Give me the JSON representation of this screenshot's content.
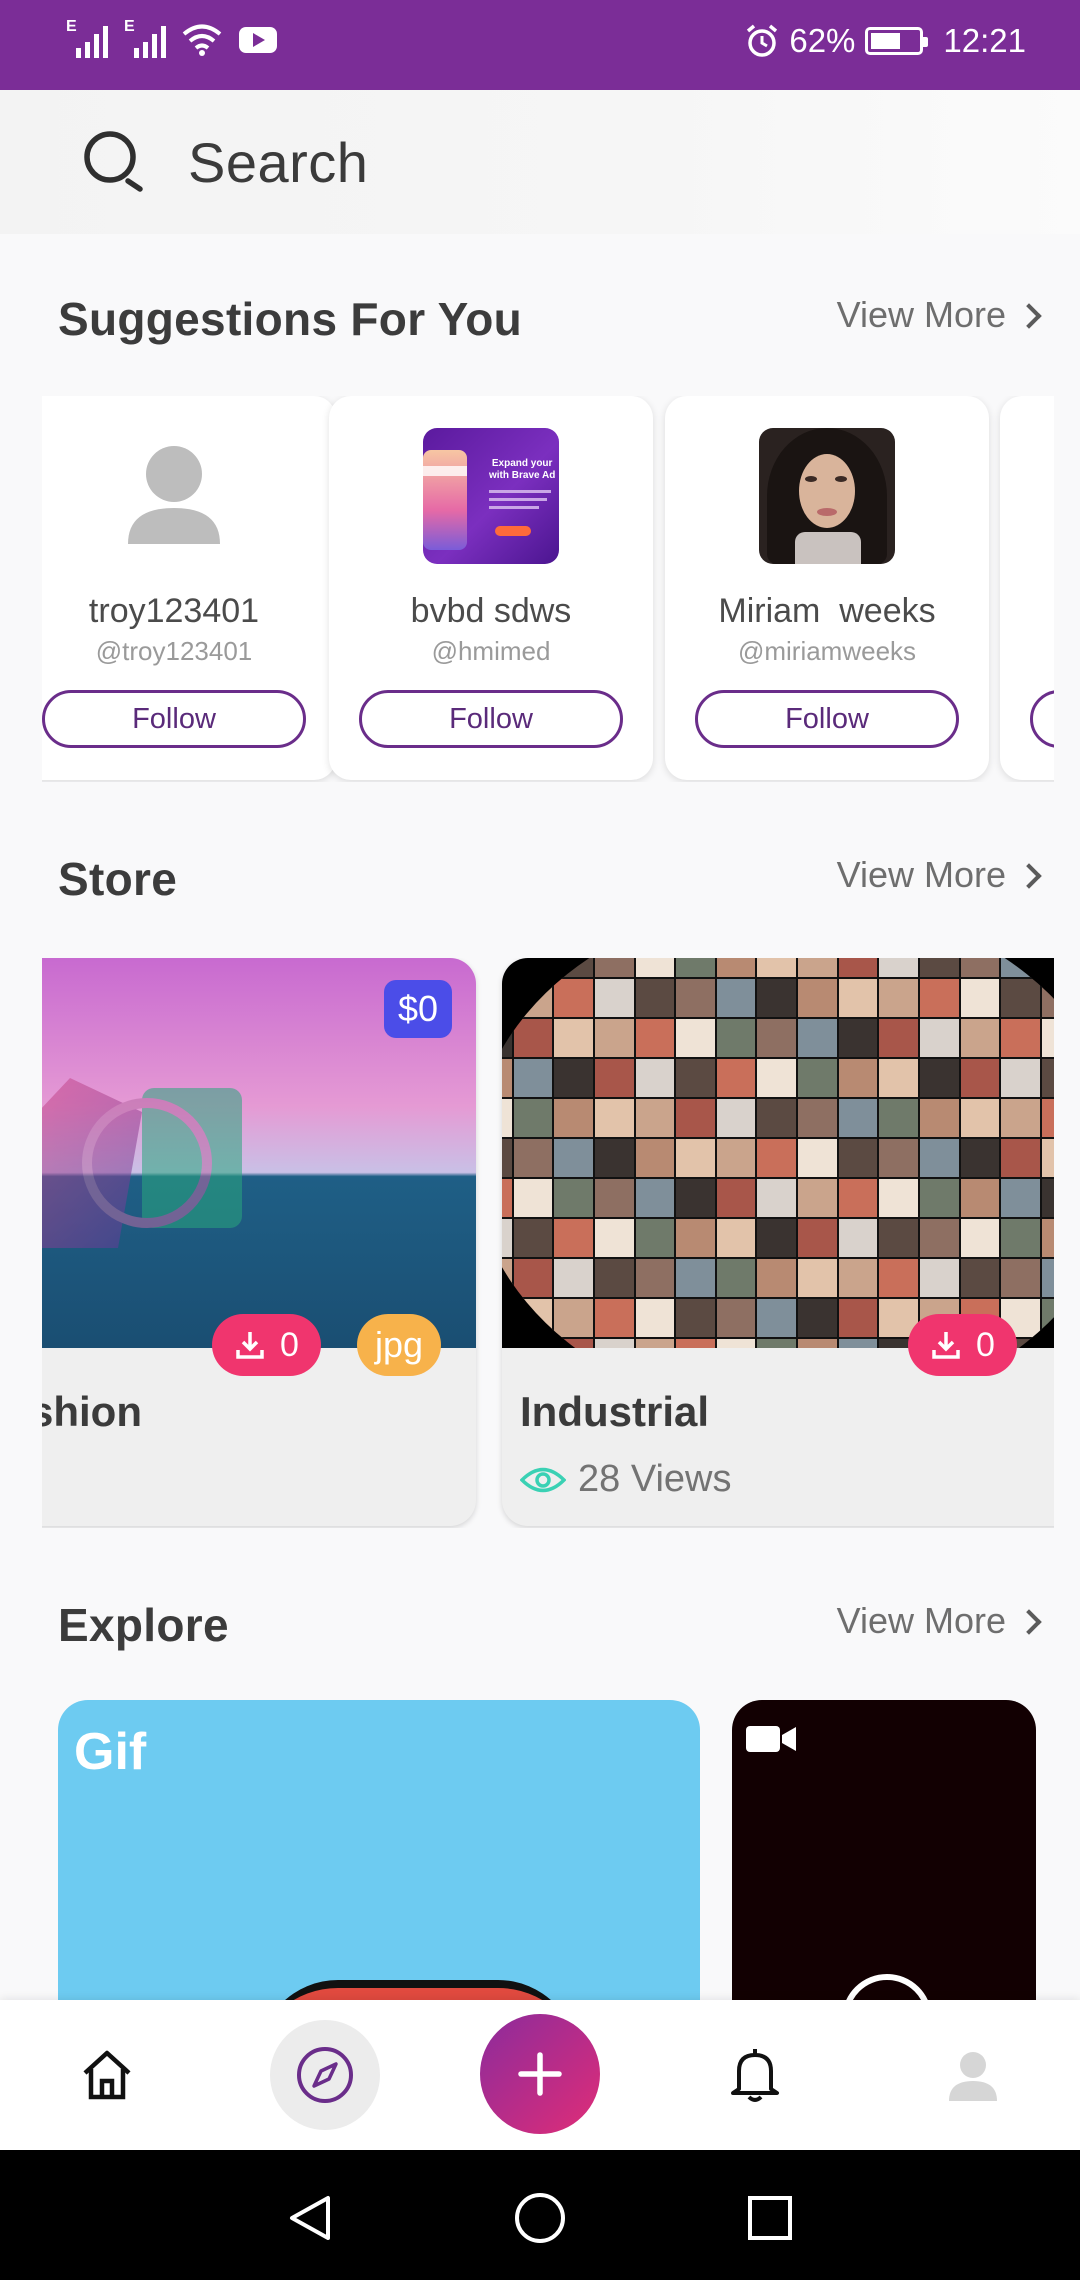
{
  "status_bar": {
    "battery": "62%",
    "time": "12:21",
    "network_label": "E",
    "battery_level": 0.62,
    "color": "#7b2d97"
  },
  "search": {
    "placeholder": "Search",
    "icon": "search-icon"
  },
  "suggestions": {
    "title": "Suggestions For You",
    "view_more": "View More",
    "items": [
      {
        "name": "troy123401",
        "handle": "@troy123401",
        "follow_label": "Follow",
        "avatar": "default-person-icon"
      },
      {
        "name": "bvbd sdws",
        "handle": "@hmimed",
        "follow_label": "Follow",
        "avatar": "promo-image",
        "avatar_text_1": "Expand your",
        "avatar_text_2": "with Brave Ad"
      },
      {
        "name": "Miriam  weeks",
        "handle": "@miriamweeks",
        "follow_label": "Follow",
        "avatar": "portrait-photo"
      }
    ]
  },
  "store": {
    "title": "Store",
    "view_more": "View More",
    "items": [
      {
        "title": "shion",
        "price": "$0",
        "downloads": "0",
        "format": "jpg"
      },
      {
        "title": "Industrial",
        "downloads": "0",
        "views": "28 Views"
      }
    ]
  },
  "explore": {
    "title": "Explore",
    "view_more": "View More",
    "items": [
      {
        "label": "Gif",
        "color": "#6dcbf1"
      },
      {
        "type": "video",
        "icon": "video-camera-icon"
      }
    ]
  },
  "bottom_nav": {
    "items": [
      "home-icon",
      "compass-icon",
      "add-icon",
      "bell-icon",
      "profile-icon"
    ],
    "accent_gradient": [
      "#8b2b9c",
      "#e02d77"
    ]
  },
  "colors": {
    "follow_border": "#6a2d8a",
    "price_badge": "#4b4de8",
    "download_badge": "#f0356e",
    "format_badge": "#f7b24b",
    "views_eye": "#3ad1b4"
  }
}
